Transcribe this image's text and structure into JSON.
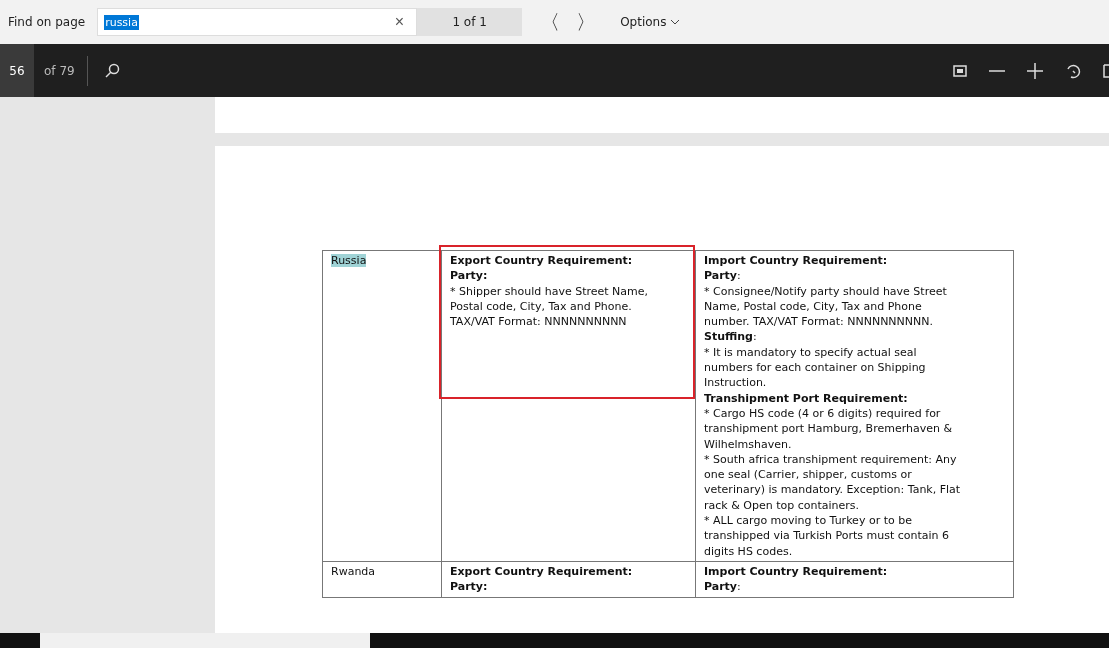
{
  "find_bar": {
    "label": "Find on page",
    "query": {
      "value": "russia",
      "selected": true
    },
    "clear": "×",
    "match_count": "1 of 1",
    "prev": "〈",
    "next": "〉",
    "options": "Options"
  },
  "toolbar": {
    "page": "56",
    "page_total": "of 79"
  },
  "table": {
    "rows": [
      {
        "country": {
          "text": "Russia",
          "highlighted": true
        },
        "export": [
          "**Export Country Requirement:**",
          "**Party:**",
          "* Shipper should have Street Name, Postal code, City, Tax and Phone. TAX/VAT Format: NNNNNNNNNN"
        ],
        "import": [
          "**Import Country Requirement:**",
          "**Party**:",
          "* Consignee/Notify party should have Street Name, Postal code, City, Tax and Phone number. TAX/VAT Format: NNNNNNNNNN.",
          "**Stuffing**:",
          "* It is mandatory to specify actual seal numbers for each container on Shipping Instruction.",
          "**Transhipment Port Requirement:**",
          "* Cargo HS code (4 or 6 digits) required for transhipment port Hamburg, Bremerhaven & Wilhelmshaven.",
          "* South africa transhipment requirement: Any one seal (Carrier, shipper, customs or veterinary) is mandatory. Exception: Tank, Flat rack & Open top containers.",
          "* ALL cargo moving to Turkey or to be transhipped via Turkish Ports must contain 6 digits HS codes."
        ]
      },
      {
        "country": {
          "text": "Rwanda",
          "highlighted": false
        },
        "export": [
          "**Export Country Requirement:**",
          "**Party:**"
        ],
        "import": [
          "**Import Country Requirement:**",
          "**Party**:"
        ]
      }
    ]
  }
}
